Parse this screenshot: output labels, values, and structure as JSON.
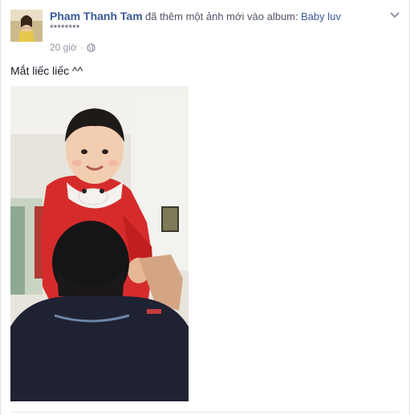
{
  "post": {
    "author": "Pham Thanh Tam",
    "action": "đã thêm một ảnh mới vào album:",
    "album": "Baby luv",
    "subline": "********",
    "time": "20 giờ",
    "separator": "·",
    "caption": "Mắt liếc liếc ^^",
    "icons": {
      "privacy": "globe-icon",
      "menu": "chevron-down-icon"
    }
  },
  "colors": {
    "link": "#3b5998",
    "muted": "#9197a3",
    "text": "#141823"
  }
}
